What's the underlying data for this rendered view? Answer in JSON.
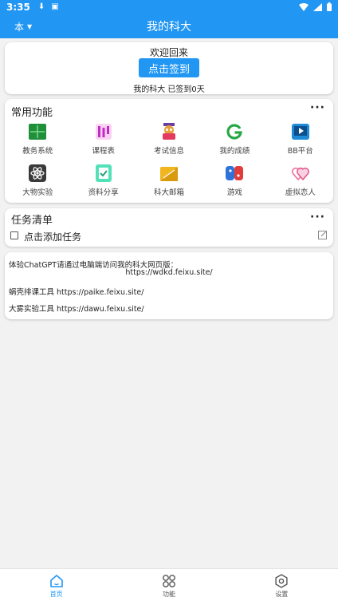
{
  "status_bar": {
    "time": "3:35"
  },
  "app_bar": {
    "selector_label": "本",
    "title": "我的科大"
  },
  "welcome": {
    "greeting": "欢迎回来",
    "sign_in_button": "点击签到",
    "status": "我的科大 已签到0天"
  },
  "features": {
    "title": "常用功能",
    "more": "···",
    "items": [
      {
        "label": "教务系统",
        "icon": "grid-table-icon"
      },
      {
        "label": "课程表",
        "icon": "schedule-icon"
      },
      {
        "label": "考试信息",
        "icon": "exam-owl-icon"
      },
      {
        "label": "我的成绩",
        "icon": "grade-g-icon"
      },
      {
        "label": "BB平台",
        "icon": "video-play-icon"
      },
      {
        "label": "大物实验",
        "icon": "atom-icon"
      },
      {
        "label": "资料分享",
        "icon": "document-check-icon"
      },
      {
        "label": "科大邮箱",
        "icon": "mail-folder-icon"
      },
      {
        "label": "游戏",
        "icon": "game-controller-icon"
      },
      {
        "label": "虚拟恋人",
        "icon": "hearts-icon"
      }
    ]
  },
  "tasks": {
    "title": "任务清单",
    "more": "···",
    "add_task": "点击添加任务"
  },
  "info": {
    "line1": "体验ChatGPT请通过电脑端访问我的科大网页版：",
    "line2": "https://wdkd.feixu.site/",
    "line3": "蜗壳排课工具 https://paike.feixu.site/",
    "line4": "大雾实验工具 https://dawu.feixu.site/"
  },
  "bottom_nav": [
    {
      "label": "首页",
      "icon": "home-icon",
      "active": true
    },
    {
      "label": "功能",
      "icon": "apps-icon",
      "active": false
    },
    {
      "label": "设置",
      "icon": "settings-gear-icon",
      "active": false
    }
  ],
  "colors": {
    "primary": "#2196f3",
    "background": "#f2f2f2"
  }
}
